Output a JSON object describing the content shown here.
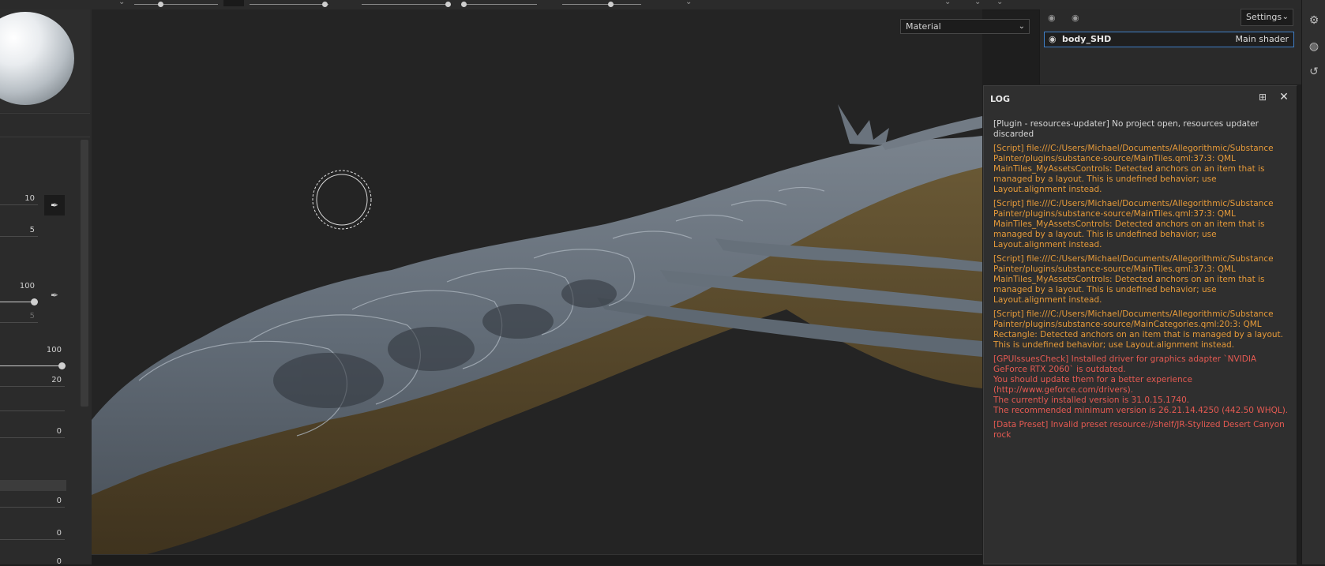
{
  "viewport": {
    "channel_select": {
      "value": "Material"
    }
  },
  "texture_sets": {
    "settings_label": "Settings",
    "items": [
      {
        "name": "body_SHD",
        "shader": "Main shader"
      }
    ]
  },
  "properties": {
    "values": [
      "10",
      "5",
      "100",
      "5",
      "100",
      "20",
      "0",
      "0",
      "0",
      "0"
    ]
  },
  "log": {
    "title": "LOG",
    "entries": [
      {
        "level": "info",
        "text": "[Plugin - resources-updater] No project open, resources updater discarded"
      },
      {
        "level": "warning",
        "text": "[Script] file:///C:/Users/Michael/Documents/Allegorithmic/Substance Painter/plugins/substance-source/MainTiles.qml:37:3: QML MainTiles_MyAssetsControls: Detected anchors on an item that is managed by a layout. This is undefined behavior; use Layout.alignment instead."
      },
      {
        "level": "warning",
        "text": "[Script] file:///C:/Users/Michael/Documents/Allegorithmic/Substance Painter/plugins/substance-source/MainTiles.qml:37:3: QML MainTiles_MyAssetsControls: Detected anchors on an item that is managed by a layout. This is undefined behavior; use Layout.alignment instead."
      },
      {
        "level": "warning",
        "text": "[Script] file:///C:/Users/Michael/Documents/Allegorithmic/Substance Painter/plugins/substance-source/MainTiles.qml:37:3: QML MainTiles_MyAssetsControls: Detected anchors on an item that is managed by a layout. This is undefined behavior; use Layout.alignment instead."
      },
      {
        "level": "warning",
        "text": "[Script] file:///C:/Users/Michael/Documents/Allegorithmic/Substance Painter/plugins/substance-source/MainCategories.qml:20:3: QML Rectangle: Detected anchors on an item that is managed by a layout. This is undefined behavior; use Layout.alignment instead."
      },
      {
        "level": "error",
        "text": "[GPUIssuesCheck] Installed driver for graphics adapter `NVIDIA GeForce RTX 2060` is outdated.\nYou should update them for a better experience (http://www.geforce.com/drivers).\nThe currently installed version is 31.0.15.1740.\nThe recommended minimum version is 26.21.14.4250 (442.50 WHQL)."
      },
      {
        "level": "error",
        "text": "[Data Preset] Invalid preset resource://shelf/JR-Stylized Desert Canyon rock"
      }
    ]
  },
  "icons": {
    "left_pen": "pen-icon",
    "undock": "undock-icon",
    "close": "close-icon",
    "visibility": "eye-icon",
    "strip": [
      "gear-icon",
      "shelf-icon",
      "history-icon"
    ]
  },
  "colors": {
    "log_info": "#d6d6d6",
    "log_warning": "#e69a39",
    "log_error": "#e55a52",
    "selection_border": "#3f7ec6",
    "model_surface": "#6d7782",
    "model_shadow": "#5a4a2c"
  }
}
